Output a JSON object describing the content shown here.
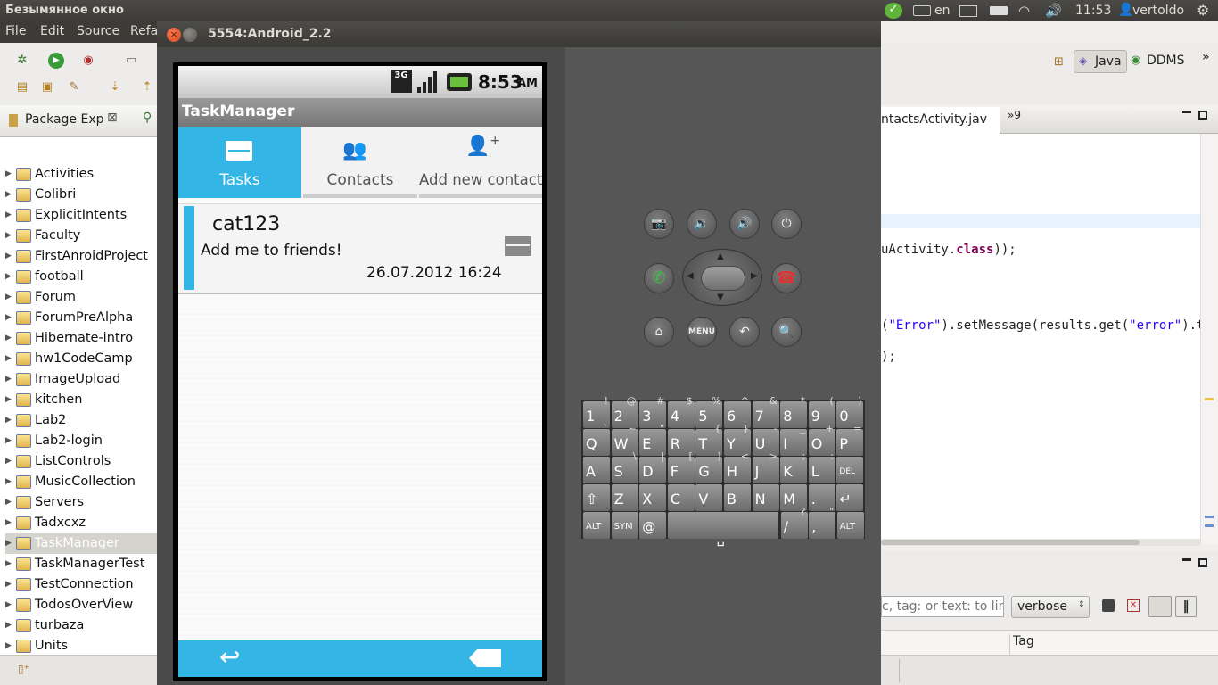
{
  "system_panel": {
    "window_title": "Безымянное окно",
    "keyboard_layout": "en",
    "clock": "11:53",
    "user": "vertoldo"
  },
  "eclipse": {
    "menu": [
      "File",
      "Edit",
      "Source",
      "Refa"
    ],
    "perspectives": {
      "java": "Java",
      "ddms": "DDMS"
    },
    "package_explorer": {
      "title": "Package Exp",
      "projects": [
        "Activities",
        "Colibri",
        "ExplicitIntents",
        "Faculty",
        "FirstAnroidProject",
        "football",
        "Forum",
        "ForumPreAlpha",
        "Hibernate-intro",
        "hw1CodeCamp",
        "ImageUpload",
        "kitchen",
        "Lab2",
        "Lab2-login",
        "ListControls",
        "MusicCollection",
        "Servers",
        "Tadxcxz",
        "TaskManager",
        "TaskManagerTest",
        "TestConnection",
        "TodosOverView",
        "turbaza",
        "Units"
      ],
      "selected": "TaskManager"
    },
    "editor": {
      "tab_label": "ntactsActivity.jav",
      "tab_overflow": "»9",
      "code_lines": [
        {
          "pre": "uActivity.",
          "kw": "class",
          "post": "));"
        },
        {
          "pre": "(",
          "str1": "\"Error\"",
          "mid": ").setMessage(results.get(",
          "str2": "\"error\"",
          "post": ").toS"
        },
        {
          "pre": ");",
          "kw": "",
          "post": ""
        }
      ]
    },
    "logcat": {
      "filter_placeholder": "c, tag: or text: to limi",
      "level": "verbose",
      "column_tag": "Tag"
    }
  },
  "emulator": {
    "window_title": "5554:Android_2.2",
    "status_time": "8:53",
    "status_ampm": "AM",
    "network": "3G",
    "app_title": "TaskManager",
    "tabs": [
      {
        "label": "Tasks",
        "icon": "envelope-icon",
        "active": true
      },
      {
        "label": "Contacts",
        "icon": "contacts-icon",
        "active": false
      },
      {
        "label": "Add new contact",
        "icon": "add-contact-icon",
        "active": false
      }
    ],
    "message": {
      "sender": "cat123",
      "text": "Add me to friends!",
      "date": "26.07.2012 16:24"
    },
    "keyboard": {
      "row1": [
        [
          "1",
          "!"
        ],
        [
          "2",
          "@"
        ],
        [
          "3",
          "#"
        ],
        [
          "4",
          "$"
        ],
        [
          "5",
          "%"
        ],
        [
          "6",
          "^"
        ],
        [
          "7",
          "&"
        ],
        [
          "8",
          "*"
        ],
        [
          "9",
          "("
        ],
        [
          "0",
          ")"
        ]
      ],
      "row2": [
        [
          "Q",
          "`"
        ],
        [
          "W",
          "~"
        ],
        [
          "E",
          "\""
        ],
        [
          "R",
          ""
        ],
        [
          "T",
          "{"
        ],
        [
          "Y",
          "}"
        ],
        [
          "U",
          "-"
        ],
        [
          "I",
          "_"
        ],
        [
          "O",
          "+"
        ],
        [
          "P",
          "="
        ]
      ],
      "row3": [
        [
          "A",
          ""
        ],
        [
          "S",
          "\\"
        ],
        [
          "D",
          "|"
        ],
        [
          "F",
          "["
        ],
        [
          "G",
          "]"
        ],
        [
          "H",
          "<"
        ],
        [
          "J",
          ">"
        ],
        [
          "K",
          ";"
        ],
        [
          "L",
          ":"
        ],
        [
          "DEL",
          ""
        ]
      ],
      "row4": [
        [
          "⇧",
          ""
        ],
        [
          "Z",
          ""
        ],
        [
          "X",
          ""
        ],
        [
          "C",
          ""
        ],
        [
          "V",
          ""
        ],
        [
          "B",
          ""
        ],
        [
          "N",
          ""
        ],
        [
          "M",
          ""
        ],
        [
          ".",
          ""
        ],
        [
          "↵",
          ""
        ]
      ],
      "row5": [
        "ALT",
        "SYM",
        "@",
        "/",
        ",",
        "ALT"
      ],
      "row5_sub": {
        "slash": "?",
        "comma": "\""
      }
    },
    "hw_buttons": {
      "menu": "MENU"
    },
    "colors": {
      "accent": "#33b5e5"
    }
  }
}
